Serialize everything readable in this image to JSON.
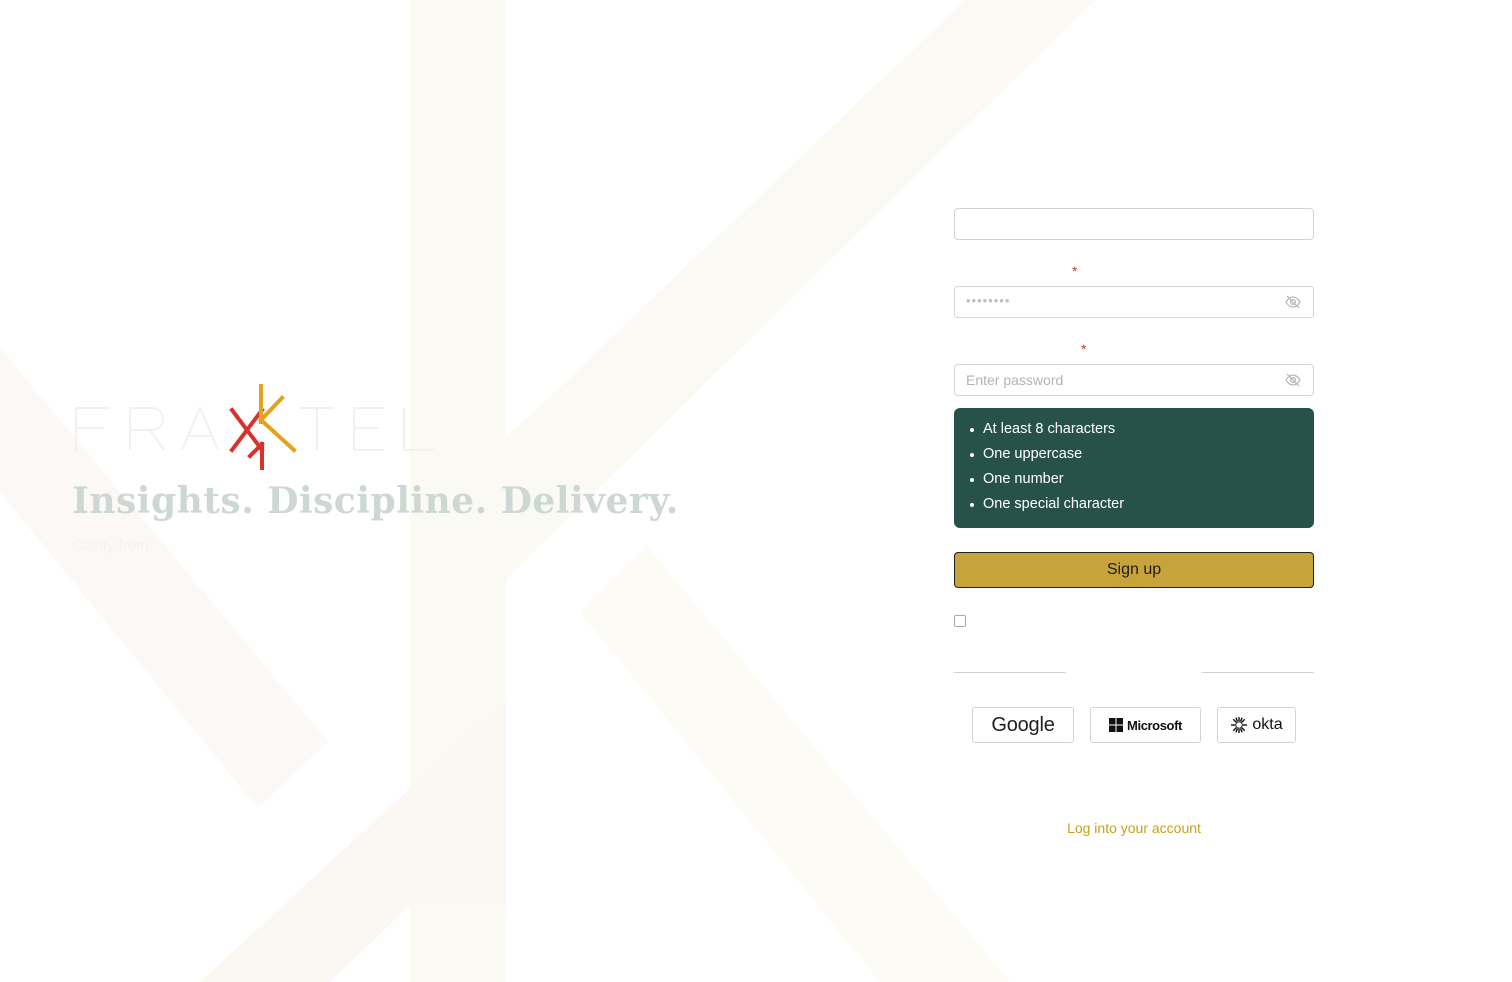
{
  "brand": {
    "logo_text": "FRAKTEL",
    "tagline": "Insights. Discipline. Delivery.",
    "subtagline": "Clarity from"
  },
  "form": {
    "password_label": "",
    "confirm_label": "",
    "password_dots": "••••••••",
    "confirm_placeholder": "Enter password",
    "rules": [
      "At least 8 characters",
      "One uppercase",
      "One number",
      "One special character"
    ],
    "signup_label": "Sign up",
    "sso_google": "Google",
    "sso_microsoft": "Microsoft",
    "sso_okta": "okta",
    "login_link": "Log into your account"
  },
  "colors": {
    "accent_gold": "#c7a33c",
    "rules_bg": "#27524c",
    "link": "#c9a11d",
    "required": "#c0392b"
  }
}
